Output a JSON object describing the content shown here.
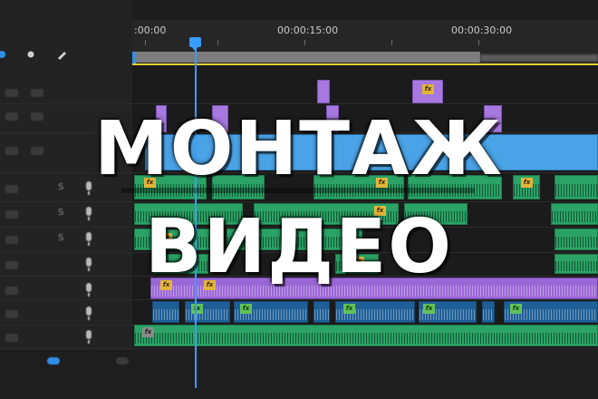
{
  "ruler": {
    "timecode_start": ":00:00",
    "timecode_mid": "00:00:15:00",
    "timecode_end": "00:00:30:00"
  },
  "tracks": {
    "solo_label": "S"
  },
  "clips": {
    "fx_label": "fx"
  },
  "overlay": {
    "line1": "МОНТАЖ",
    "line2": "ВИДЕО"
  },
  "colors": {
    "accent_blue": "#3b9cff",
    "work_area_yellow": "#e2d232",
    "video_purple": "#a779e0",
    "video_blue": "#4aa3e6",
    "audio_green": "#2ba366",
    "fx_badge": "#e3b43a"
  }
}
